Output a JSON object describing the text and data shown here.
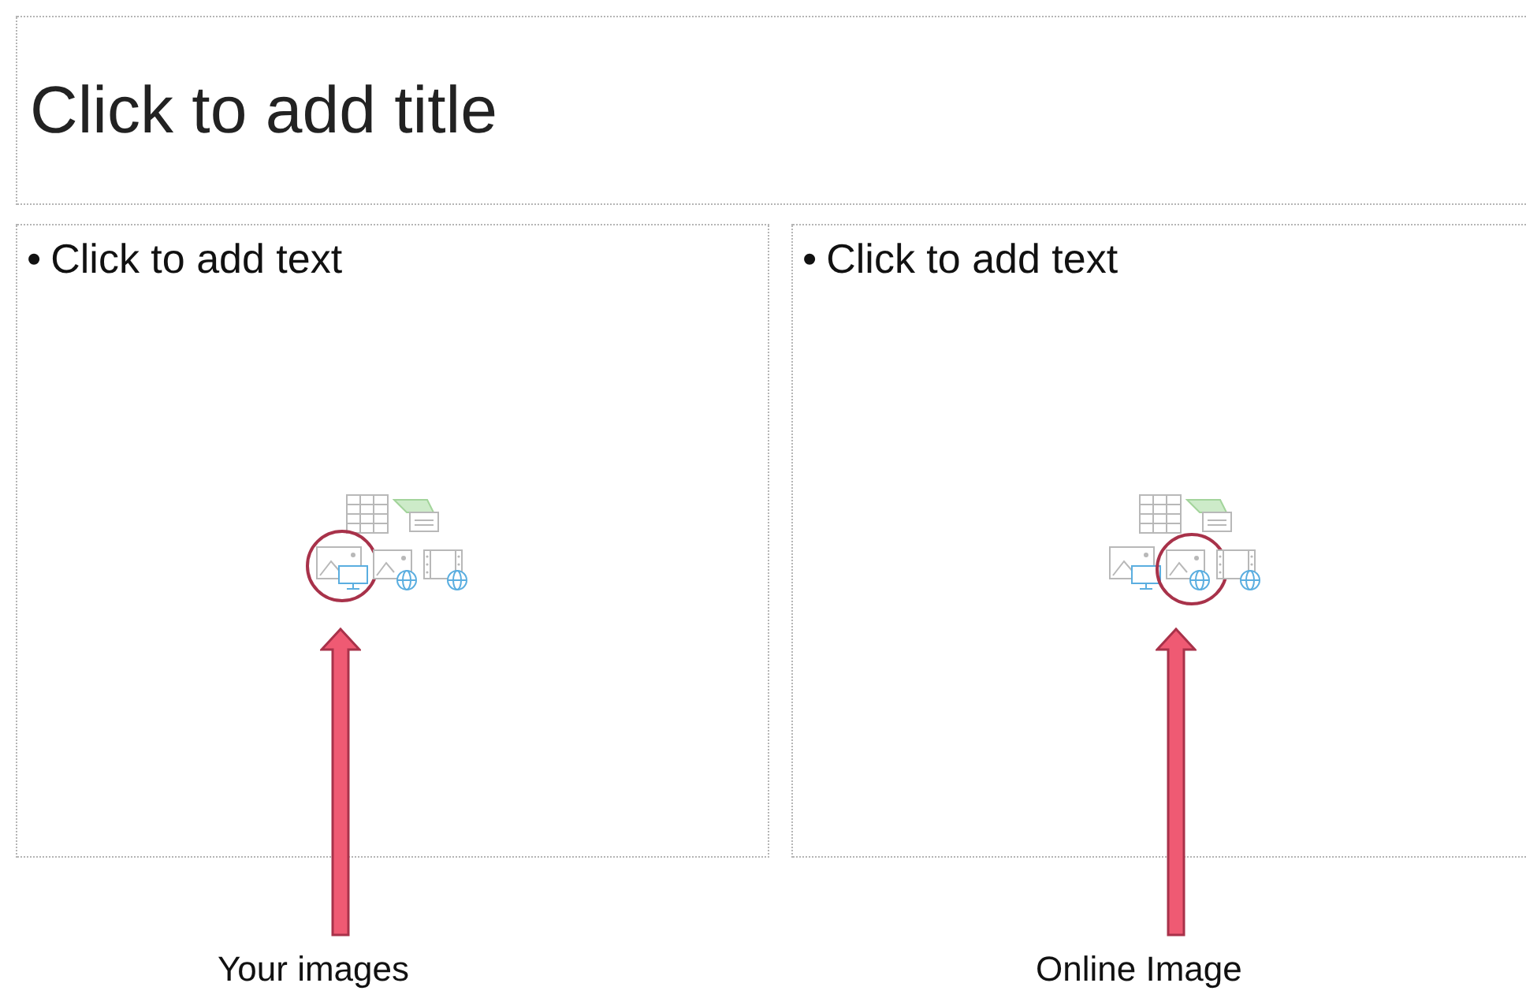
{
  "slide": {
    "title_placeholder": {
      "text": "Click to add title"
    },
    "content_placeholders": [
      {
        "bullet": "•",
        "text": "Click to add text",
        "insert_icons": [
          {
            "kind": "table",
            "circled": false
          },
          {
            "kind": "smartart",
            "circled": false
          },
          {
            "kind": "pictures",
            "circled": true
          },
          {
            "kind": "online_pictures",
            "circled": false
          },
          {
            "kind": "online_video",
            "circled": false
          }
        ]
      },
      {
        "bullet": "•",
        "text": "Click to add text",
        "insert_icons": [
          {
            "kind": "table",
            "circled": false
          },
          {
            "kind": "smartart",
            "circled": false
          },
          {
            "kind": "pictures",
            "circled": false
          },
          {
            "kind": "online_pictures",
            "circled": true
          },
          {
            "kind": "online_video",
            "circled": false
          }
        ]
      }
    ]
  },
  "callouts": [
    {
      "label": "Your images"
    },
    {
      "label": "Online Image"
    }
  ]
}
